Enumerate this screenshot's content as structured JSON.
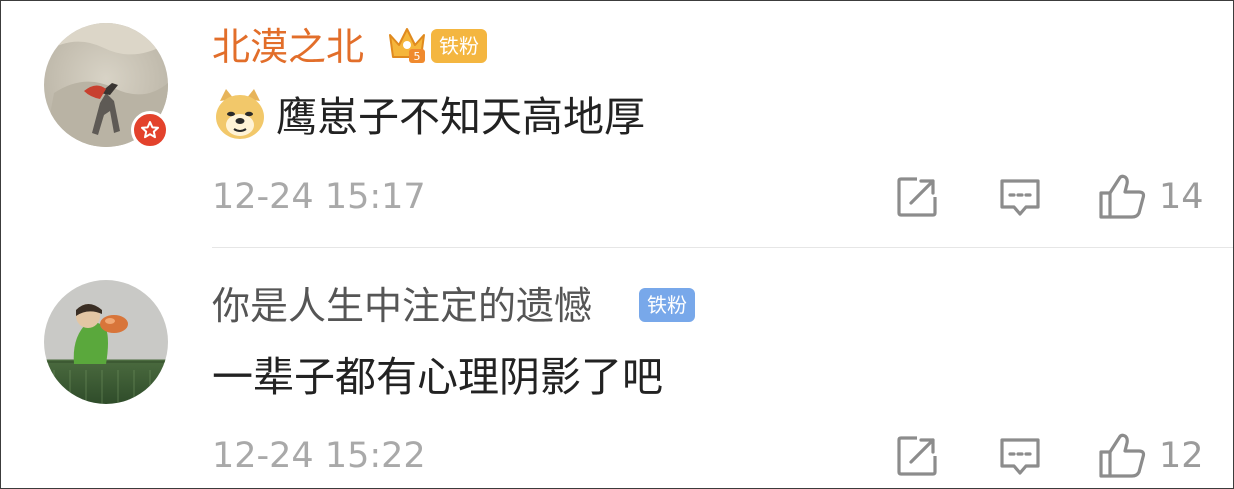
{
  "comments": [
    {
      "username": "北漠之北",
      "fan_badge": "铁粉",
      "text": "鹰崽子不知天高地厚",
      "timestamp": "12-24 15:17",
      "like_count": "14",
      "name_color": "#e26e2a",
      "badge_color": "#f4b640",
      "verified": true,
      "emoji": "doge-emoji-icon"
    },
    {
      "username": "你是人生中注定的遗憾",
      "fan_badge": "铁粉",
      "text": "一辈子都有心理阴影了吧",
      "timestamp": "12-24 15:22",
      "like_count": "12",
      "name_color": "#555555",
      "badge_color": "#78a8ea",
      "verified": false
    }
  ],
  "icons": [
    "share-icon",
    "reply-icon",
    "like-icon"
  ]
}
